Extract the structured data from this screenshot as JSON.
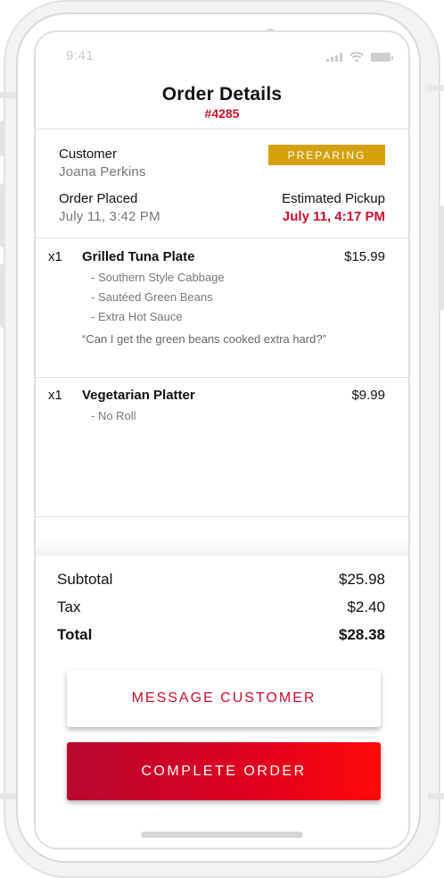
{
  "status_bar": {
    "time": "9:41"
  },
  "header": {
    "title": "Order Details",
    "order_number": "#4285"
  },
  "customer": {
    "label": "Customer",
    "name": "Joana Perkins",
    "status": "PREPARING"
  },
  "order_placed": {
    "label": "Order Placed",
    "value": "July 11, 3:42 PM"
  },
  "pickup": {
    "label": "Estimated Pickup",
    "value": "July 11, 4:17 PM"
  },
  "items": [
    {
      "qty": "x1",
      "name": "Grilled Tuna Plate",
      "price": "$15.99",
      "modifiers": [
        "- Southern Style Cabbage",
        "- Sautéed Green Beans",
        "- Extra Hot Sauce"
      ],
      "note": "“Can I get the green beans cooked extra hard?”"
    },
    {
      "qty": "x1",
      "name": "Vegetarian Platter",
      "price": "$9.99",
      "modifiers": [
        "- No Roll"
      ]
    }
  ],
  "totals": {
    "subtotal_label": "Subtotal",
    "subtotal": "$25.98",
    "tax_label": "Tax",
    "tax": "$2.40",
    "total_label": "Total",
    "total": "$28.38"
  },
  "actions": {
    "message_label": "MESSAGE CUSTOMER",
    "complete_label": "COMPLETE ORDER"
  },
  "colors": {
    "accent": "#c8102e",
    "status_badge": "#d4a10a"
  }
}
